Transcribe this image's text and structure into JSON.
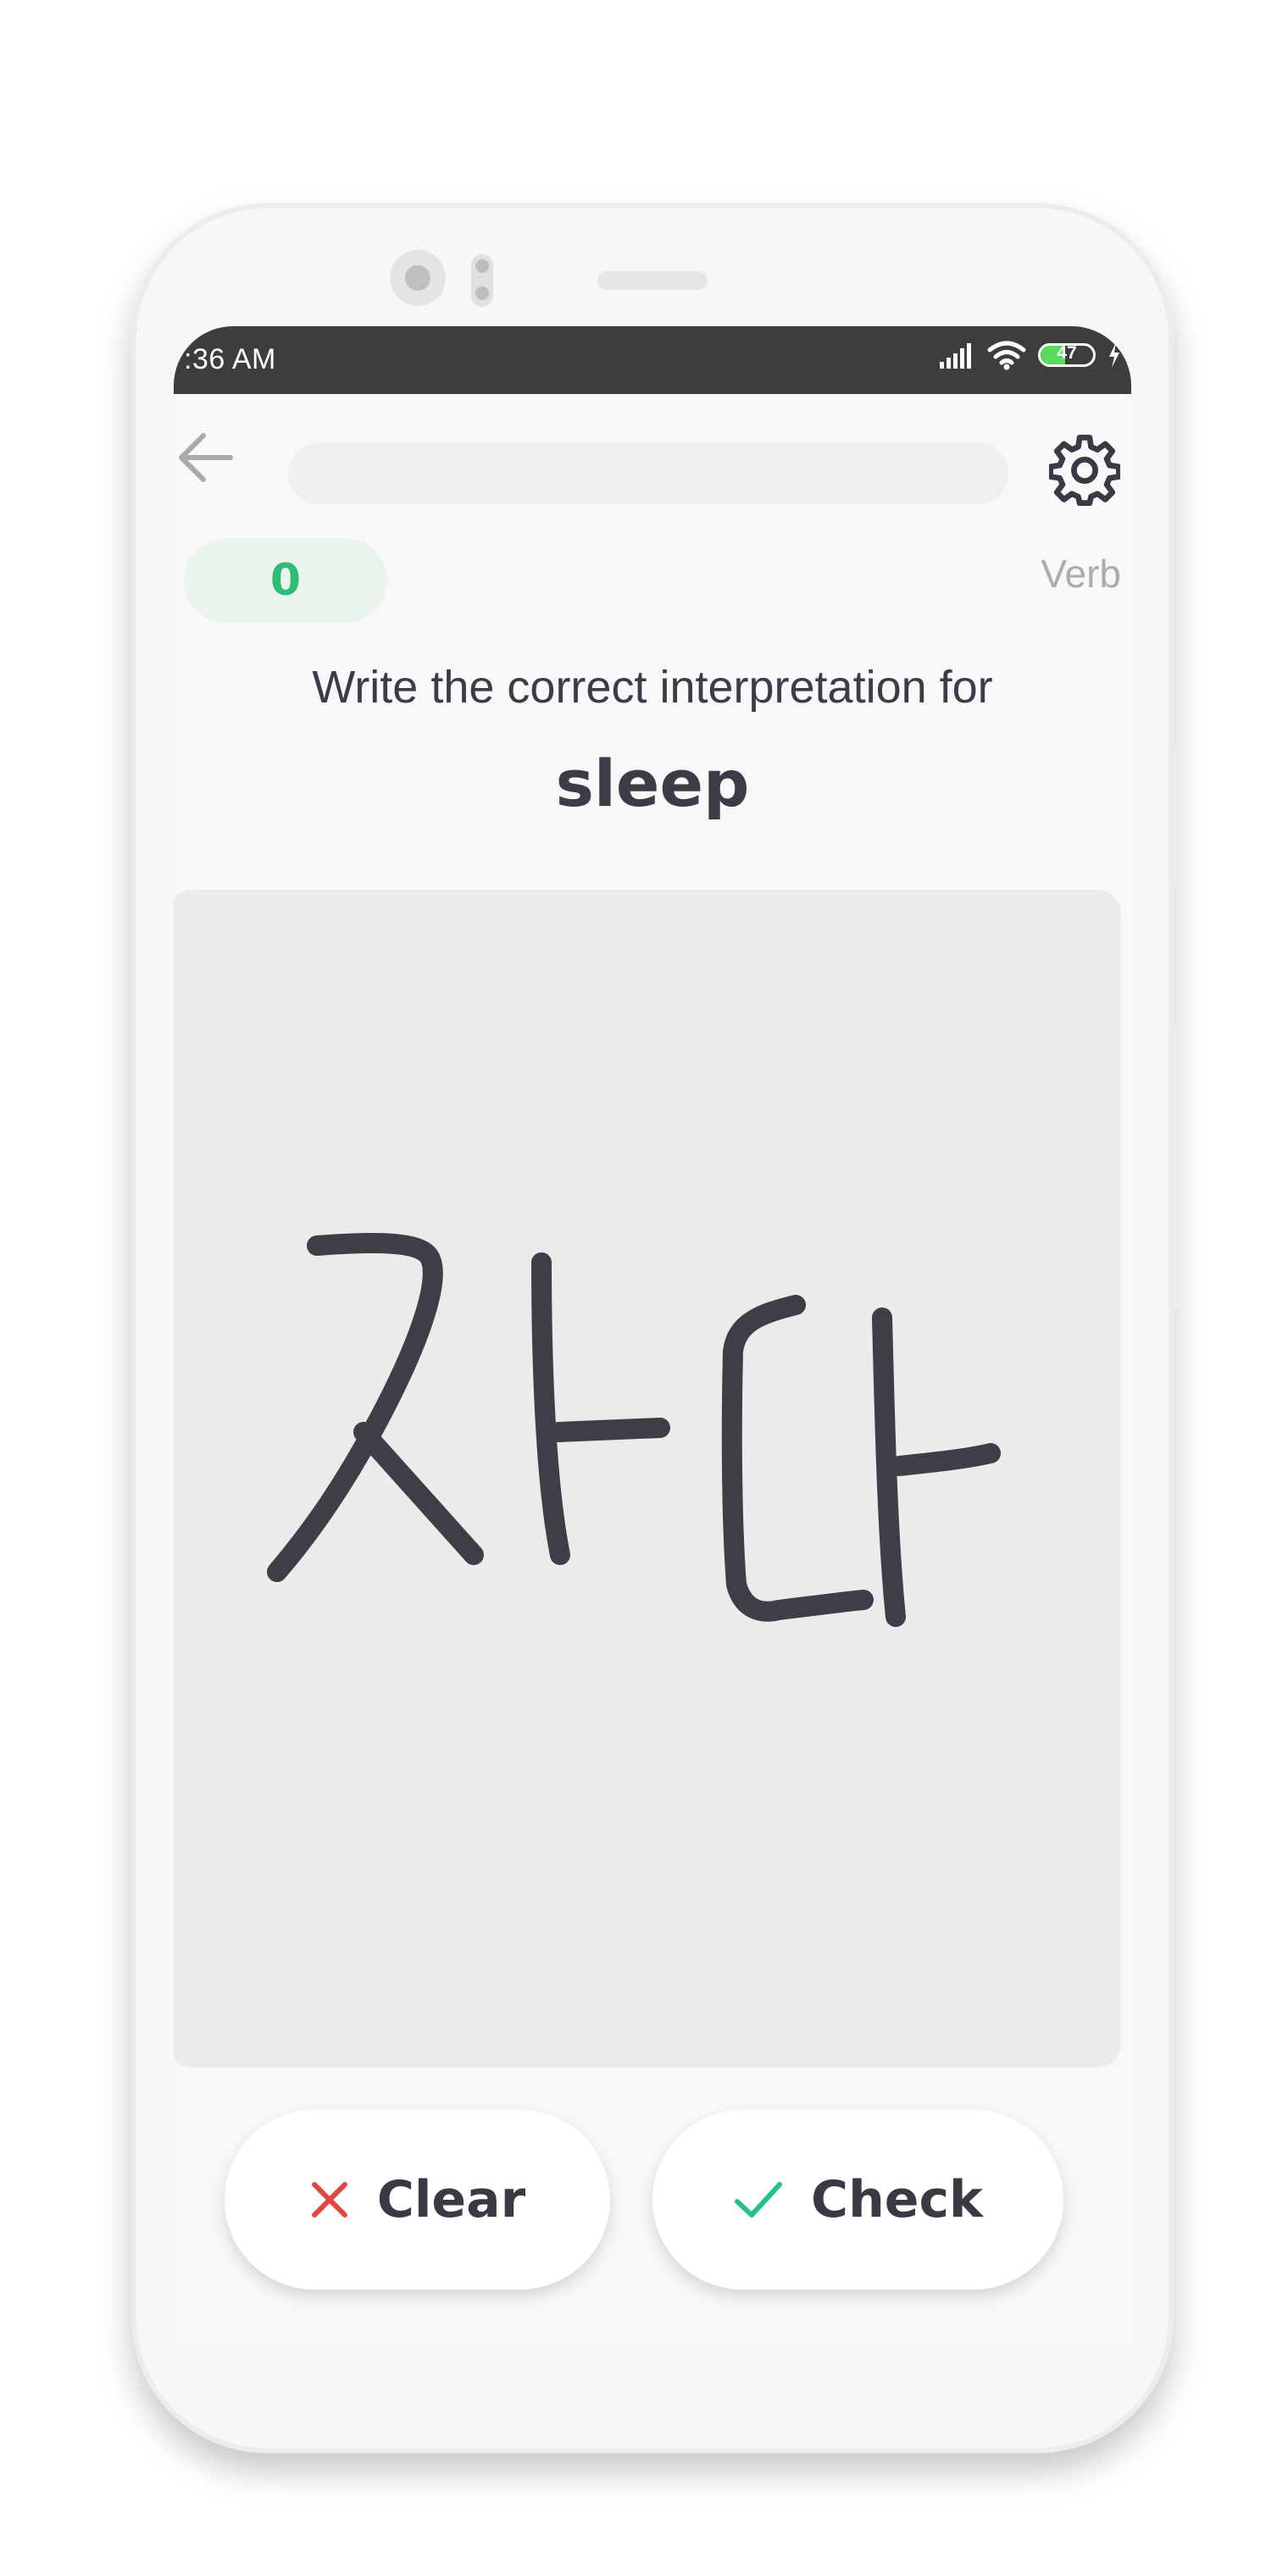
{
  "status_bar": {
    "time": ":36 AM",
    "battery_level": "47"
  },
  "header": {
    "back_icon": "arrow-left-icon",
    "settings_icon": "gear-icon",
    "progress_fraction": 0
  },
  "quiz": {
    "score": "0",
    "word_type": "Verb",
    "prompt": "Write the correct interpretation for",
    "word": "sleep"
  },
  "drawing_canvas": {
    "handwritten_text": "자다",
    "stroke_color": "#3f3e47"
  },
  "actions": {
    "clear_label": "Clear",
    "clear_icon": "close-icon",
    "check_label": "Check",
    "check_icon": "checkmark-icon"
  },
  "colors": {
    "accent_green": "#24c18c",
    "clear_red": "#e0473e",
    "text_dark": "#3c3c46",
    "muted": "#acacac"
  }
}
